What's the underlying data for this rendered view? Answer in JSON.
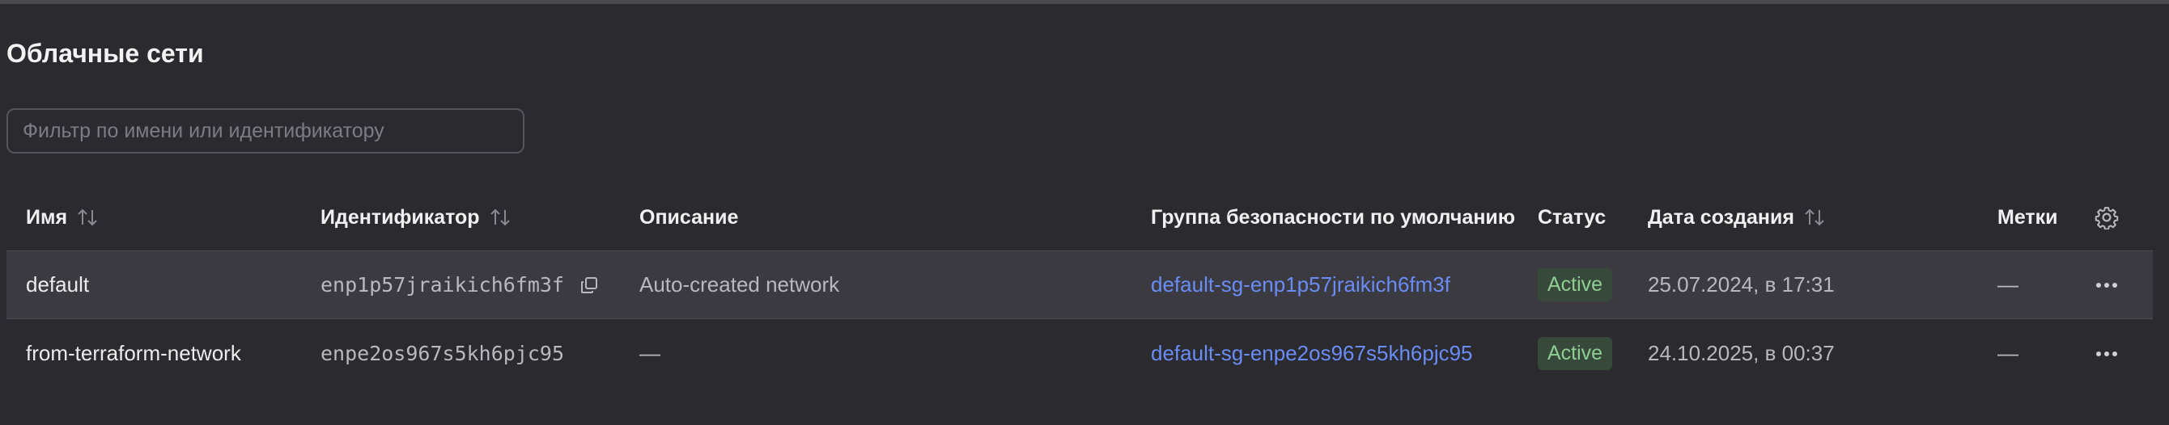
{
  "page": {
    "title": "Облачные сети"
  },
  "filter": {
    "placeholder": "Фильтр по имени или идентификатору",
    "value": ""
  },
  "table": {
    "headers": {
      "name": "Имя",
      "id": "Идентификатор",
      "description": "Описание",
      "security_group": "Группа безопасности по умолчанию",
      "status": "Статус",
      "created": "Дата создания",
      "labels": "Метки"
    },
    "rows": [
      {
        "name": "default",
        "id": "enp1p57jraikich6fm3f",
        "description": "Auto-created network",
        "security_group": "default-sg-enp1p57jraikich6fm3f",
        "status": "Active",
        "created": "25.07.2024, в 17:31",
        "labels": "—"
      },
      {
        "name": "from-terraform-network",
        "id": "enpe2os967s5kh6pjc95",
        "description": "—",
        "security_group": "default-sg-enpe2os967s5kh6pjc95",
        "status": "Active",
        "created": "24.10.2025, в 00:37",
        "labels": "—"
      }
    ]
  },
  "colors": {
    "background": "#2b2a2f",
    "link": "#6a8cf5",
    "status_active_text": "#8fce92",
    "status_active_bg": "#37493a"
  },
  "icons": {
    "sort": "sort-arrows-icon",
    "copy": "copy-icon",
    "settings": "gear-icon",
    "row_menu": "more-horizontal-icon"
  }
}
